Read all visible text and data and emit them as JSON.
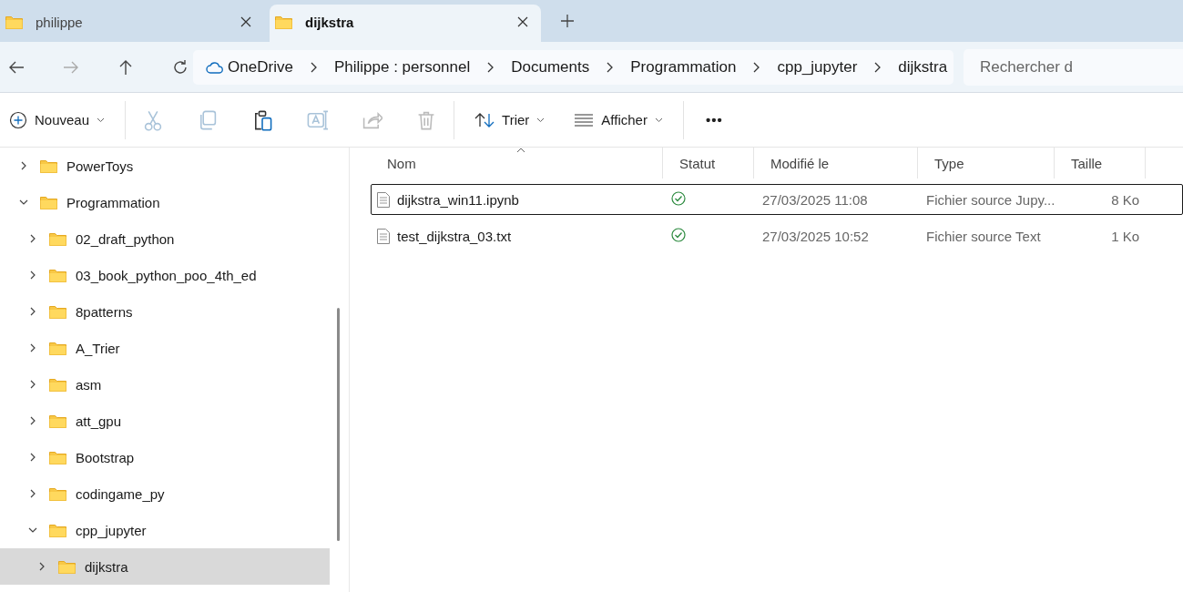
{
  "tabs": [
    {
      "label": "philippe",
      "selected": false
    },
    {
      "label": "dijkstra",
      "selected": true
    }
  ],
  "breadcrumb": [
    "OneDrive",
    "Philippe : personnel",
    "Documents",
    "Programmation",
    "cpp_jupyter",
    "dijkstra"
  ],
  "search": {
    "placeholder": "Rechercher d"
  },
  "toolbar": {
    "new_label": "Nouveau",
    "sort_label": "Trier",
    "view_label": "Afficher",
    "more": "•••",
    "actions": [
      {
        "kind": "cut",
        "disabled": true
      },
      {
        "kind": "copy",
        "disabled": true
      },
      {
        "kind": "paste",
        "disabled": false
      },
      {
        "kind": "rename",
        "disabled": true
      },
      {
        "kind": "share",
        "disabled": true
      },
      {
        "kind": "delete",
        "disabled": true
      }
    ]
  },
  "sidebar": {
    "items": [
      {
        "label": "PowerToys",
        "expanded": false,
        "selected": false
      },
      {
        "label": "Programmation",
        "expanded": true,
        "selected": false,
        "children": [
          {
            "label": "02_draft_python",
            "expanded": false,
            "selected": false
          },
          {
            "label": "03_book_python_poo_4th_ed",
            "expanded": false,
            "selected": false
          },
          {
            "label": "8patterns",
            "expanded": false,
            "selected": false
          },
          {
            "label": "A_Trier",
            "expanded": false,
            "selected": false
          },
          {
            "label": "asm",
            "expanded": false,
            "selected": false
          },
          {
            "label": "att_gpu",
            "expanded": false,
            "selected": false
          },
          {
            "label": "Bootstrap",
            "expanded": false,
            "selected": false
          },
          {
            "label": "codingame_py",
            "expanded": false,
            "selected": false
          },
          {
            "label": "cpp_jupyter",
            "expanded": true,
            "selected": false,
            "children": [
              {
                "label": "dijkstra",
                "expanded": false,
                "selected": true
              }
            ]
          }
        ]
      }
    ]
  },
  "table": {
    "columns": [
      "Nom",
      "Statut",
      "Modifié le",
      "Type",
      "Taille"
    ],
    "rows": [
      {
        "name": "dijkstra_win11.ipynb",
        "modified": "27/03/2025 11:08",
        "type": "Fichier source Jupy...",
        "size": "8 Ko",
        "focused": true
      },
      {
        "name": "test_dijkstra_03.txt",
        "modified": "27/03/2025 10:52",
        "type": "Fichier source Text",
        "size": "1 Ko",
        "focused": false
      }
    ]
  }
}
